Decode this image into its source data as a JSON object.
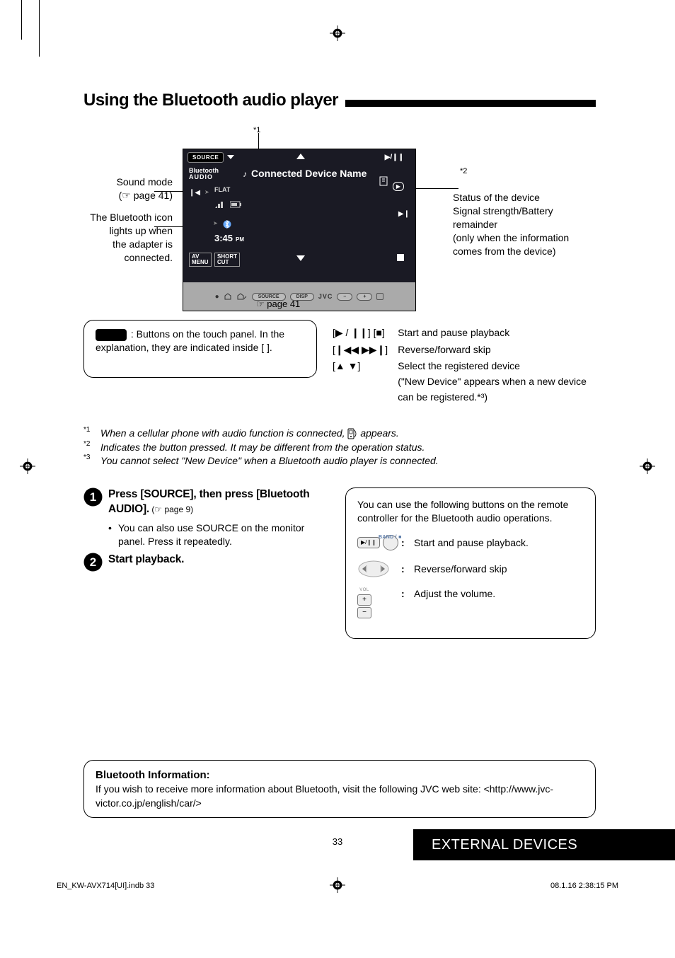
{
  "heading": "Using the Bluetooth audio player",
  "diagram": {
    "star1": "*1",
    "star2": "*2",
    "panel": {
      "source": "SOURCE",
      "sub_line1": "Bluetooth",
      "sub_line2": "AUDIO",
      "device_name": "Connected Device Name",
      "flat": "FLAT",
      "clock": "3:45",
      "ampm": "PM",
      "avmenu": "AV\nMENU",
      "shortcut": "SHORT\nCUT",
      "brand": "JVC",
      "bottom_source": "SOURCE",
      "bottom_disp": "DISP"
    },
    "label_sound_mode_1": "Sound mode",
    "label_sound_mode_2": "(☞ page 41)",
    "label_bt_1": "The Bluetooth icon",
    "label_bt_2": "lights up when",
    "label_bt_3": "the adapter is",
    "label_bt_4": "connected.",
    "label_status_1": "Status of the device",
    "label_status_2": "Signal strength/Battery",
    "label_status_3": "remainder",
    "label_status_4": "(only when the information",
    "label_status_5": "comes from the device)",
    "page_ref_below": "☞ page 41",
    "legend_text": ": Buttons on the touch panel. In the explanation, they are indicated inside [       ].",
    "btn_legend": {
      "r1_sym": "[▶ / ❙❙]  [■]",
      "r1_txt": "Start and pause playback",
      "r2_sym": "[❙◀◀ ▶▶❙]",
      "r2_txt": "Reverse/forward skip",
      "r3_sym": "[▲ ▼]",
      "r3_txt_a": "Select the registered device",
      "r3_txt_b": "(\"New Device\" appears when a new device can be registered.*³)"
    }
  },
  "footnotes": {
    "n1": "*1",
    "t1a": "When a cellular phone with audio function is connected, ",
    "t1b": " appears.",
    "n2": "*2",
    "t2": "Indicates the button pressed. It may be different from the operation status.",
    "n3": "*3",
    "t3": "You cannot select \"New Device\" when a Bluetooth audio player is connected."
  },
  "steps": {
    "s1_bold": "Press [SOURCE], then press [Bluetooth AUDIO].",
    "s1_sub": " (☞ page 9)",
    "s1_bullet": "You can also use SOURCE on the monitor panel. Press it repeatedly.",
    "s2_bold": "Start playback."
  },
  "remote": {
    "intro": "You can use the following buttons on the remote controller for the Bluetooth audio operations.",
    "band": "BAND / ■",
    "r1": "Start and pause playback.",
    "r2": "Reverse/forward skip",
    "vol_label": "VOL",
    "r3": "Adjust the volume."
  },
  "info_box": {
    "title": "Bluetooth Information:",
    "body": "If you wish to receive more information about Bluetooth, visit the following JVC web site: <http://www.jvc-victor.co.jp/english/car/>"
  },
  "page_number": "33",
  "footer_bar": "EXTERNAL DEVICES",
  "slug_left": "EN_KW-AVX714[UI].indb   33",
  "slug_right": "08.1.16   2:38:15 PM"
}
